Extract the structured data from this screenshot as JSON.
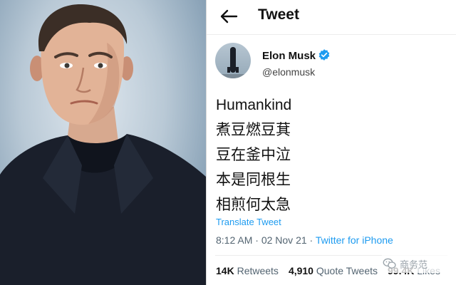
{
  "header": {
    "title": "Tweet",
    "back_icon": "arrow-left-icon"
  },
  "author": {
    "name": "Elon Musk",
    "handle": "@elonmusk",
    "verified": true,
    "verified_color": "#1d9bf0"
  },
  "body_lines": [
    "Humankind",
    "煮豆燃豆萁",
    "豆在釜中泣",
    "本是同根生",
    "相煎何太急"
  ],
  "translate_label": "Translate Tweet",
  "meta": {
    "time": "8:12 AM",
    "separator": " · ",
    "date": "02 Nov 21",
    "separator2": " · ",
    "source": "Twitter for iPhone"
  },
  "stats": {
    "retweets_count": "14K",
    "retweets_label": "Retweets",
    "quotes_count": "4,910",
    "quotes_label": "Quote Tweets",
    "likes_count": "99.4K",
    "likes_label": "Likes"
  },
  "watermark": {
    "text": "商务范"
  },
  "colors": {
    "link": "#1d9bf0",
    "text": "#111111",
    "muted": "#536471"
  }
}
